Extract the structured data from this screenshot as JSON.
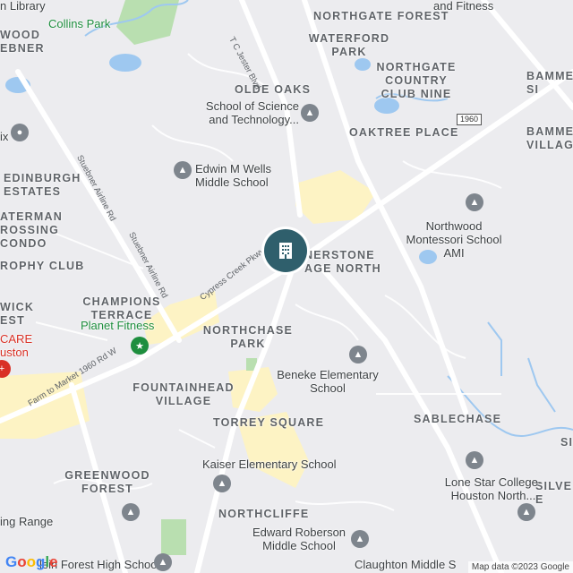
{
  "map": {
    "areas": {
      "waterford_park": "WATERFORD PARK",
      "northgate_forest": "NORTHGATE FOREST",
      "olde_oaks": "OLDE OAKS",
      "northgate_country_club_nine": "NORTHGATE COUNTRY CLUB NINE",
      "oaktree_place": "OAKTREE PLACE",
      "bammel_village": "BAMMEL VILLAGE",
      "bammel_top": "BAMMEL SI",
      "edinburgh_estates": "EDINBURGH ESTATES",
      "waterman_crossing": "ATERMAN ROSSING CONDO",
      "trophy_club": "ROPHY CLUB",
      "champions_terrace": "CHAMPIONS TERRACE",
      "northchase_park": "NORTHCHASE PARK",
      "cornerstone_village_north": "NERSTONE AGE NORTH",
      "fountainhead_village": "FOUNTAINHEAD VILLAGE",
      "torrey_square": "TORREY SQUARE",
      "sablechase": "SABLECHASE",
      "greenwood_forest": "GREENWOOD FOREST",
      "northcliffe": "NORTHCLIFFE",
      "wood_weber": "WOOD EBNER",
      "wick_est": "WICK EST",
      "silver_e": "SILVE E",
      "si_right": "SI"
    },
    "pois": {
      "collins_park": "Collins Park",
      "library": "n Library",
      "fitness_top": "and Fitness",
      "school_science": "School of Science and Technology...",
      "edwin_wells": "Edwin M Wells Middle School",
      "northwood_montessori": "Northwood Montessori School AMI",
      "planet_fitness": "Planet Fitness",
      "beneke": "Beneke Elementary School",
      "kaiser": "Kaiser Elementary School",
      "lone_star": "Lone Star College-Houston North...",
      "edward_roberson": "Edward Roberson Middle School",
      "klein_forest": "lein Forest High School",
      "claughton": "Claughton Middle S",
      "hcare": "CARE uston",
      "range": "ing Range",
      "ix": "ix"
    },
    "roads": {
      "tc_jester": "T C Jester Blvd",
      "stuebner_1": "Stuebner Airline Rd",
      "stuebner_2": "Stuebner Airline Rd",
      "cypress_creek": "Cypress Creek Pkwy",
      "fm1960": "Farm to Market 1960 Rd W",
      "shield_1960": "1960"
    },
    "attribution": "Map data ©2023 Google",
    "logo_letters": [
      "G",
      "o",
      "o",
      "g",
      "l",
      "e"
    ],
    "colors": {
      "background": "#ececef",
      "road_major": "#ffffff",
      "commercial": "#fdf3c4",
      "water": "#9ec8f0",
      "park": "#b9dfb0",
      "marker": "#2f5f6c",
      "pin_grey": "#7e858d",
      "pin_green": "#1e8e3e"
    },
    "icons": [
      "building-marker-icon",
      "school-icon",
      "place-icon",
      "fitness-icon",
      "hospital-icon"
    ]
  }
}
